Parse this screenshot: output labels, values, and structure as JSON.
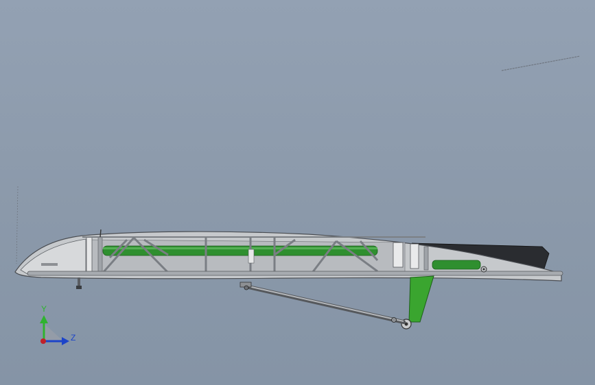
{
  "viewport": {
    "background_top": "#93a1b3",
    "background_bottom": "#8594a6"
  },
  "model": {
    "skin_color": "#c6c9cc",
    "tube_color": "#2f8f2f",
    "bracket_color": "#3aa52f",
    "flap_color": "#2a2c30"
  },
  "triad": {
    "y_label": "Y",
    "z_label": "Z",
    "y_color": "#2fb32f",
    "z_color": "#1c44c9",
    "origin_color": "#c0202a"
  }
}
